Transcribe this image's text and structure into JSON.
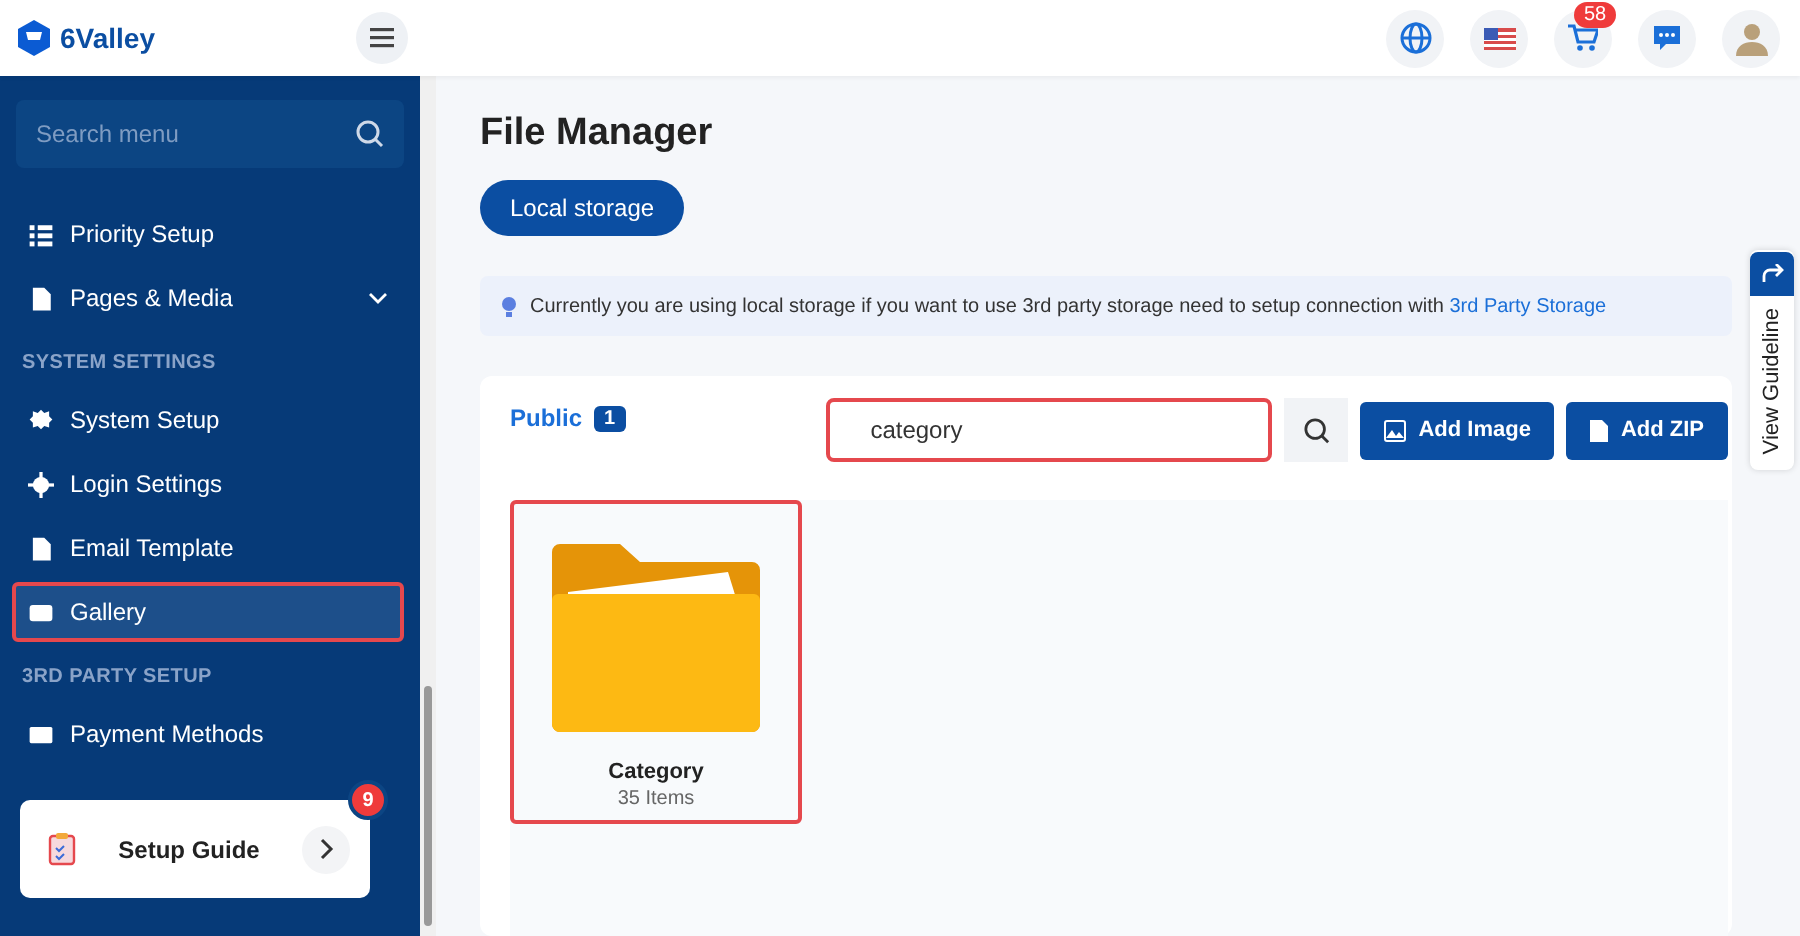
{
  "header": {
    "logo": "6Valley",
    "cart_count": "58"
  },
  "sidebar": {
    "search_placeholder": "Search menu",
    "items": [
      {
        "kind": "item",
        "label": "Priority Setup",
        "has_submenu": false,
        "selected": false,
        "highlighted": false
      },
      {
        "kind": "item",
        "label": "Pages & Media",
        "has_submenu": true,
        "selected": false,
        "highlighted": false
      },
      {
        "kind": "heading",
        "label": "SYSTEM SETTINGS"
      },
      {
        "kind": "item",
        "label": "System Setup",
        "has_submenu": false,
        "selected": false,
        "highlighted": false
      },
      {
        "kind": "item",
        "label": "Login Settings",
        "has_submenu": false,
        "selected": false,
        "highlighted": false
      },
      {
        "kind": "item",
        "label": "Email Template",
        "has_submenu": false,
        "selected": false,
        "highlighted": false
      },
      {
        "kind": "item",
        "label": "Gallery",
        "has_submenu": false,
        "selected": true,
        "highlighted": true
      },
      {
        "kind": "heading",
        "label": "3RD PARTY SETUP"
      },
      {
        "kind": "item",
        "label": "Payment Methods",
        "has_submenu": false,
        "selected": false,
        "highlighted": false
      }
    ],
    "setup_guide": {
      "label": "Setup Guide",
      "badge": "9"
    }
  },
  "main": {
    "title": "File Manager",
    "storage_button": "Local storage",
    "notice": {
      "text": "Currently you are using local storage if you want to use 3rd party storage need to setup connection with",
      "link": "3rd Party Storage"
    },
    "tabs": [
      {
        "label": "Public",
        "count": "1",
        "selected": true
      }
    ],
    "search": {
      "value": "category",
      "highlighted": true
    },
    "buttons": [
      {
        "kind": "image",
        "label": "Add Image"
      },
      {
        "kind": "zip",
        "label": "Add ZIP"
      }
    ],
    "folders": [
      {
        "name": "Category",
        "count": "35 Items",
        "highlighted": true
      }
    ]
  },
  "side_tab": {
    "label": "View Guideline"
  }
}
